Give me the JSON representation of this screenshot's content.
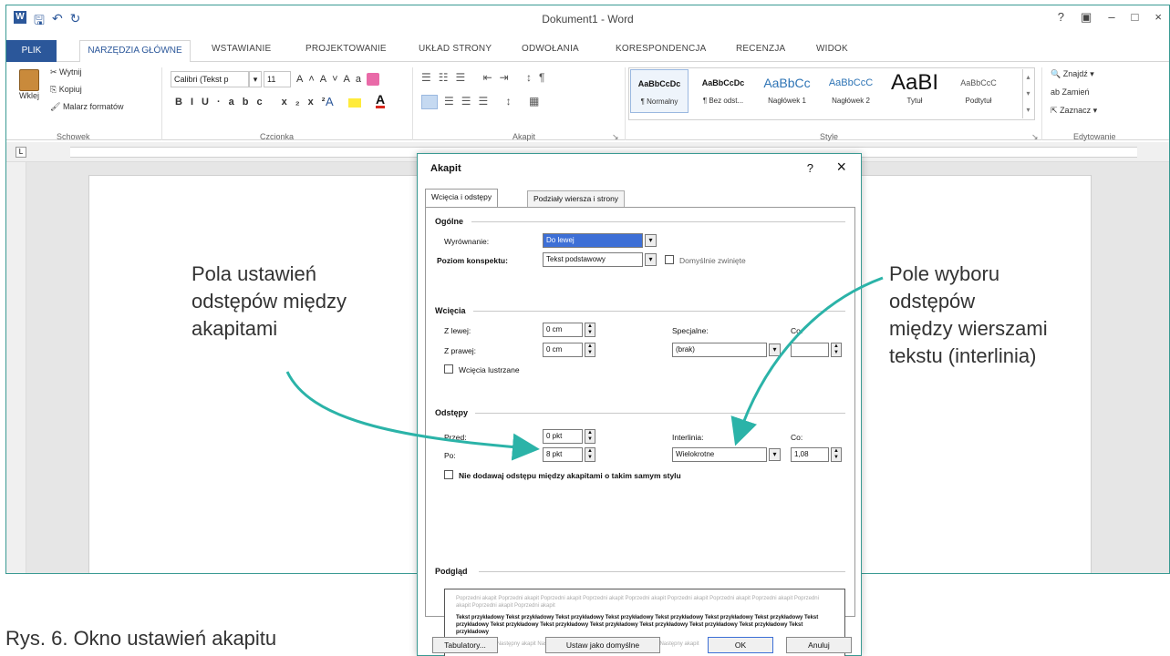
{
  "window": {
    "title": "Dokument1 - Word",
    "controls": [
      "?",
      "▣",
      "–",
      "□",
      "×"
    ],
    "qat_icons": [
      "save-icon",
      "undo-icon",
      "redo-icon"
    ]
  },
  "ribbon_tabs": [
    "PLIK",
    "NARZĘDZIA GŁÓWNE",
    "WSTAWIANIE",
    "PROJEKTOWANIE",
    "UKŁAD STRONY",
    "ODWOŁANIA",
    "KORESPONDENCJA",
    "RECENZJA",
    "WIDOK"
  ],
  "clipboard": {
    "paste": "Wklej",
    "cut": "Wytnij",
    "copy": "Kopiuj",
    "format_painter": "Malarz formatów",
    "label": "Schowek"
  },
  "font": {
    "name": "Calibri (Tekst p",
    "size": "11",
    "label": "Czcionka"
  },
  "paragraph_group_label": "Akapit",
  "styles": {
    "label": "Style",
    "items": [
      {
        "preview": "AaBbCcDc",
        "name": "¶ Normalny"
      },
      {
        "preview": "AaBbCcDc",
        "name": "¶ Bez odst..."
      },
      {
        "preview": "AaBbCc",
        "name": "Nagłówek 1"
      },
      {
        "preview": "AaBbCcC",
        "name": "Nagłówek 2"
      },
      {
        "preview": "AaBI",
        "name": "Tytuł"
      },
      {
        "preview": "AaBbCcC",
        "name": "Podtytuł"
      }
    ]
  },
  "editing": {
    "find": "Znajdź",
    "replace": "Zamień",
    "select": "Zaznacz",
    "label": "Edytowanie"
  },
  "dialog": {
    "title": "Akapit",
    "help": "?",
    "close": "×",
    "tabs": [
      "Wcięcia i odstępy",
      "Podziały wiersza i strony"
    ],
    "general": {
      "heading": "Ogólne",
      "alignment_label": "Wyrównanie:",
      "alignment_value": "Do lewej",
      "outline_label": "Poziom konspektu:",
      "outline_value": "Tekst podstawowy",
      "collapsed_label": "Domyślnie zwinięte"
    },
    "indent": {
      "heading": "Wcięcia",
      "left_label": "Z lewej:",
      "left_value": "0 cm",
      "right_label": "Z prawej:",
      "right_value": "0 cm",
      "special_label": "Specjalne:",
      "special_value": "(brak)",
      "by_label": "Co:",
      "mirror_label": "Wcięcia lustrzane"
    },
    "spacing": {
      "heading": "Odstępy",
      "before_label": "Przed:",
      "before_value": "0 pkt",
      "after_label": "Po:",
      "after_value": "8 pkt",
      "line_label": "Interlinia:",
      "line_value": "Wielokrotne",
      "at_label": "Co:",
      "at_value": "1,08",
      "dont_add_label": "Nie dodawaj odstępu między akapitami o takim samym stylu"
    },
    "preview": {
      "heading": "Podgląd",
      "prev_text": "Poprzedni akapit Poprzedni akapit Poprzedni akapit Poprzedni akapit Poprzedni akapit Poprzedni akapit Poprzedni akapit Poprzedni akapit Poprzedni akapit Poprzedni akapit Poprzedni akapit",
      "sample_text": "Tekst przykładowy Tekst przykładowy Tekst przykładowy Tekst przykładowy Tekst przykładowy Tekst przykładowy Tekst przykładowy Tekst przykładowy Tekst przykładowy Tekst przykładowy Tekst przykładowy Tekst przykładowy Tekst przykładowy Tekst przykładowy Tekst przykładowy",
      "next_text": "Następny akapit Następny akapit Następny akapit Następny akapit Następny akapit Następny akapit"
    },
    "buttons": {
      "tabs": "Tabulatory...",
      "default": "Ustaw jako domyślne",
      "ok": "OK",
      "cancel": "Anuluj"
    }
  },
  "annotations": {
    "left": [
      "Pola ustawień",
      "odstępów między",
      "akapitami"
    ],
    "right": [
      "Pole wyboru",
      "odstępów",
      "między wierszami",
      "tekstu (interlinia)"
    ],
    "accent_color": "#2bb3a8"
  },
  "caption": "Rys. 6. Okno ustawień akapitu"
}
